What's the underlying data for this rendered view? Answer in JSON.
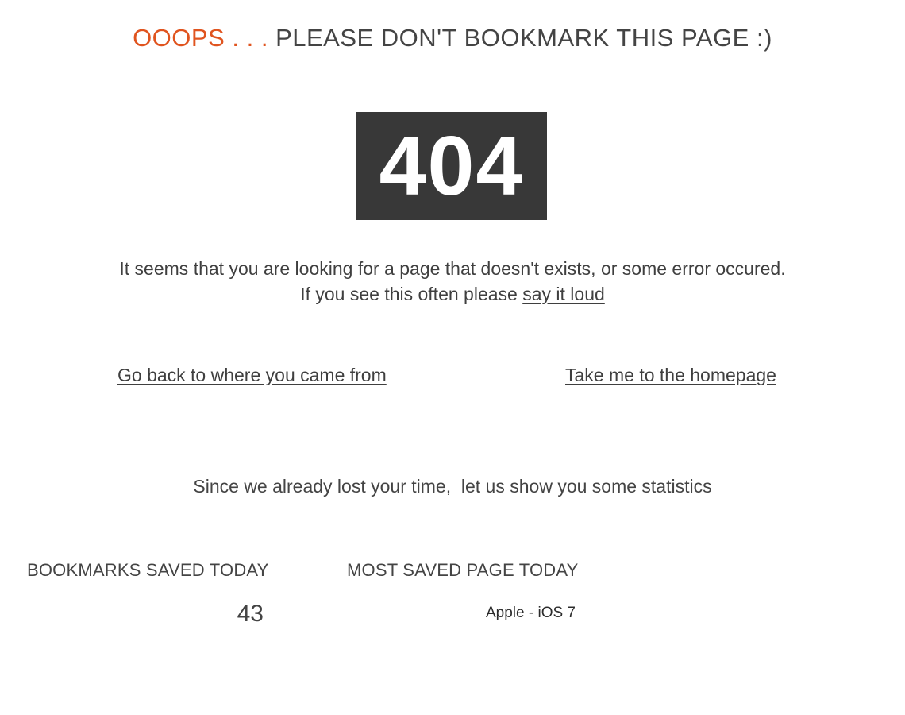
{
  "headline": {
    "accent": "OOOPS . . .",
    "rest": "PLEASE DON'T BOOKMARK THIS PAGE :)"
  },
  "error_code": "404",
  "message": {
    "line1": "It seems that you are looking for a page that doesn't exists, or some error occured.",
    "line2_prefix": "If you see this often please",
    "line2_link": "say it loud"
  },
  "links": {
    "back": "Go back to where you came from",
    "home": "Take me to the homepage"
  },
  "stats": {
    "intro": "Since we already lost your time,  let us show you some statistics",
    "bookmarks_heading": "BOOKMARKS SAVED TODAY",
    "bookmarks_value": "43",
    "most_saved_heading": "MOST SAVED PAGE TODAY",
    "most_saved_value": "Apple - iOS 7"
  },
  "colors": {
    "accent": "#e0541f",
    "code_box_bg": "#383838",
    "text": "#3b3b3b"
  }
}
